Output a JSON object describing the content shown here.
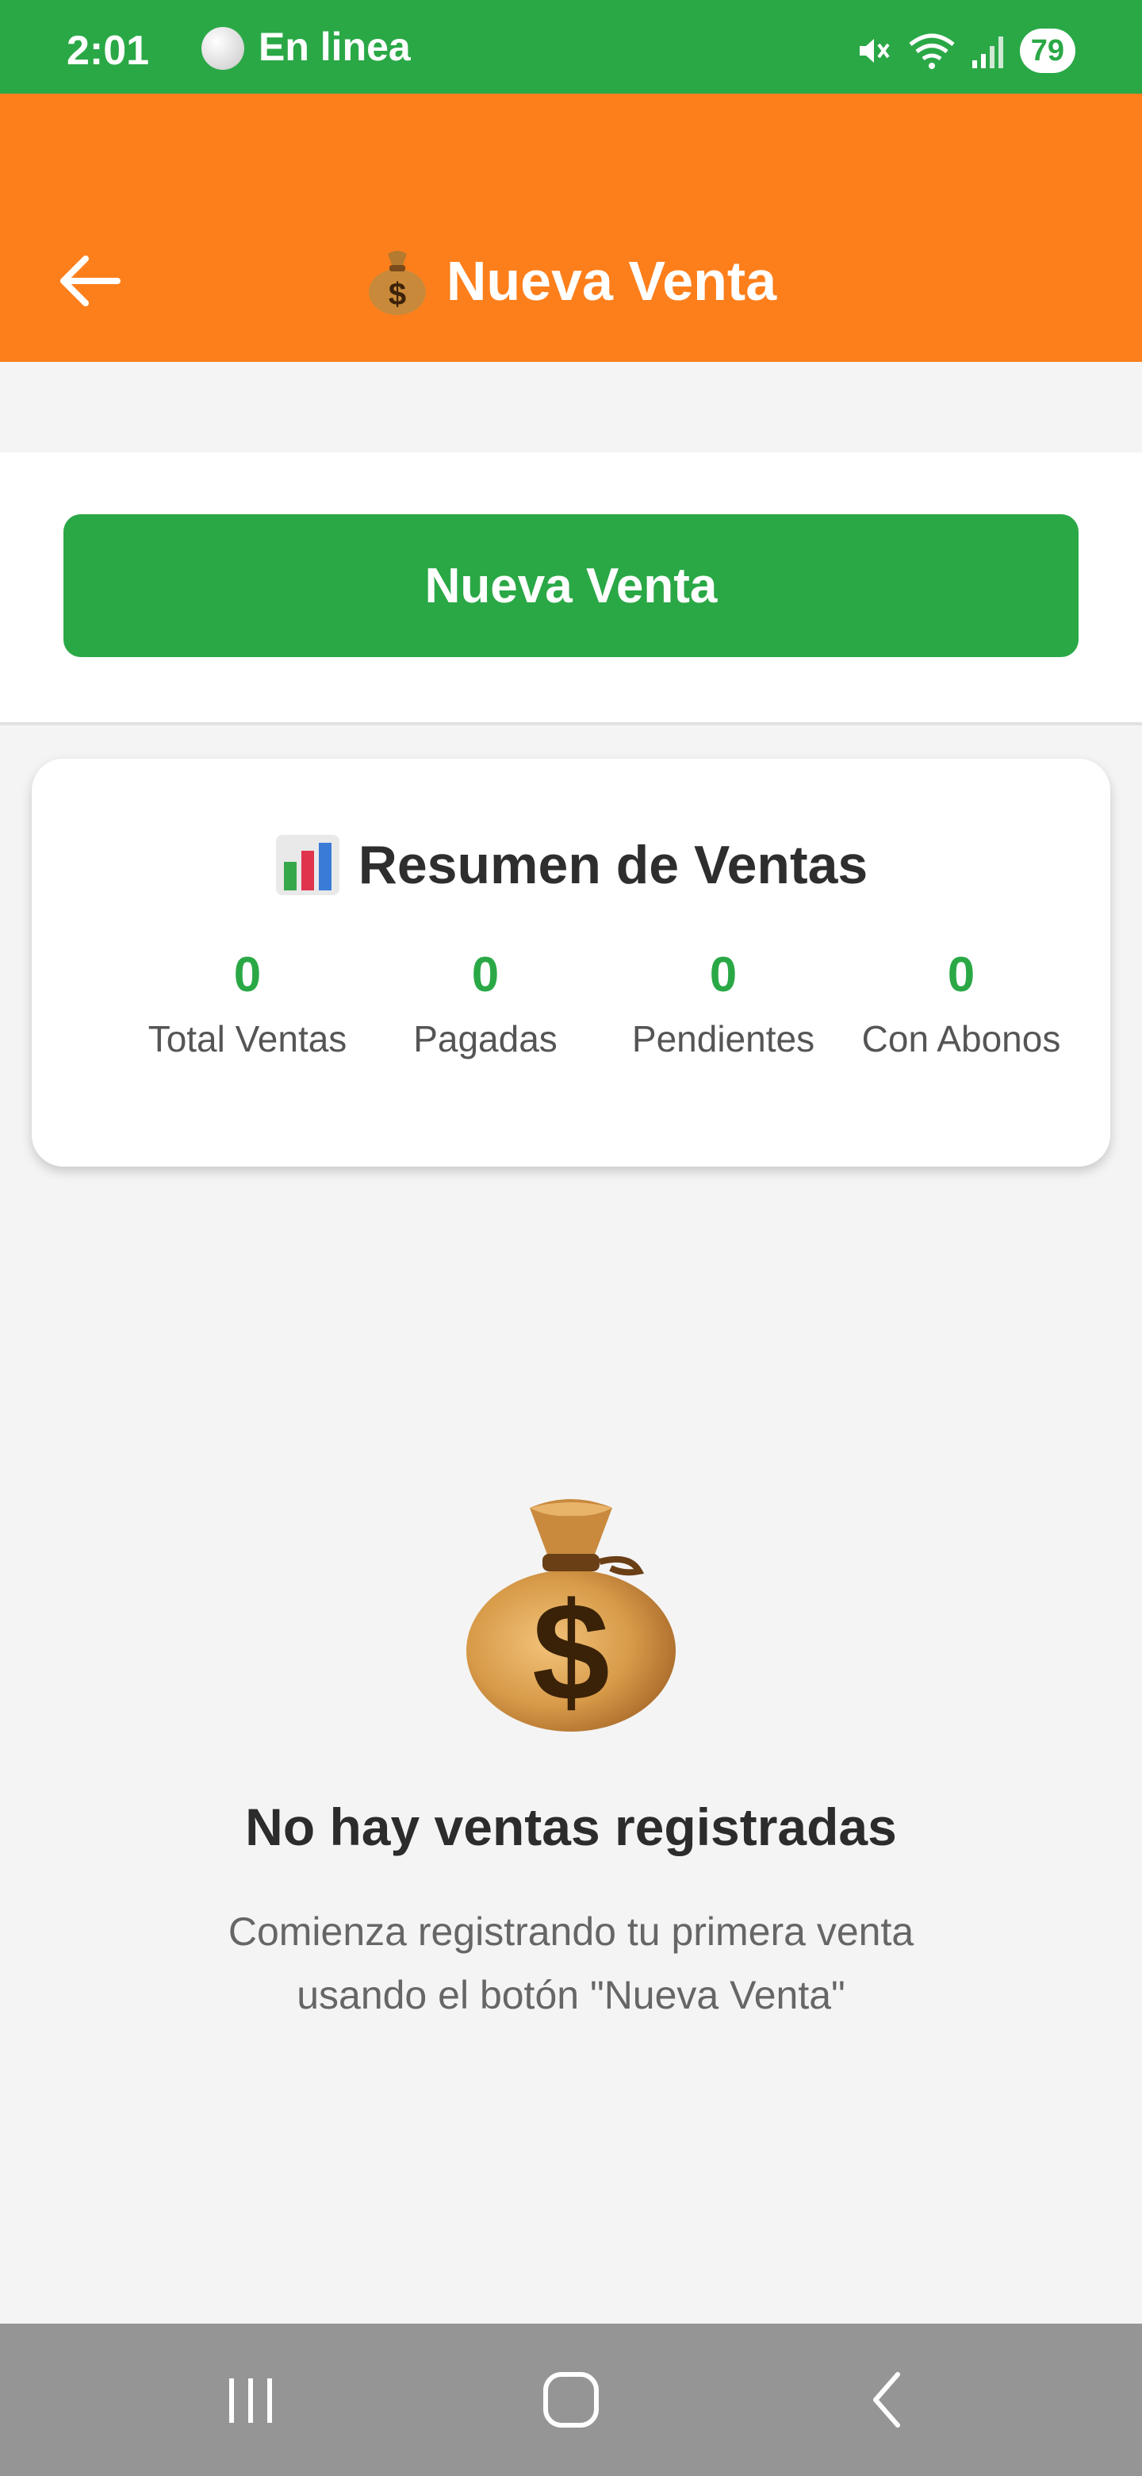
{
  "status_bar": {
    "time": "2:01",
    "online_label": "En linea",
    "battery": "79",
    "icons": [
      "mute-vibrate-icon",
      "wifi-icon",
      "signal-icon",
      "battery-icon"
    ]
  },
  "app_bar": {
    "back_icon": "arrow-left-icon",
    "title": "Nueva Venta",
    "title_icon": "money-bag-icon"
  },
  "actions": {
    "new_sale_label": "Nueva Venta"
  },
  "summary": {
    "title": "Resumen de Ventas",
    "title_icon": "bar-chart-icon",
    "stats": [
      {
        "value": "0",
        "label": "Total Ventas"
      },
      {
        "value": "0",
        "label": "Pagadas"
      },
      {
        "value": "0",
        "label": "Pendientes"
      },
      {
        "value": "0",
        "label": "Con Abonos"
      }
    ]
  },
  "empty_state": {
    "icon": "money-bag-icon",
    "title": "No hay ventas registradas",
    "subtitle_line1": "Comienza registrando tu primera venta",
    "subtitle_line2": "usando el botón \"Nueva Venta\""
  },
  "nav_bar": {
    "buttons": [
      "recent-apps-icon",
      "home-icon",
      "back-icon"
    ]
  },
  "colors": {
    "status_green": "#2aa846",
    "app_bar_orange": "#fd7f1c",
    "accent_green": "#2aa846"
  }
}
